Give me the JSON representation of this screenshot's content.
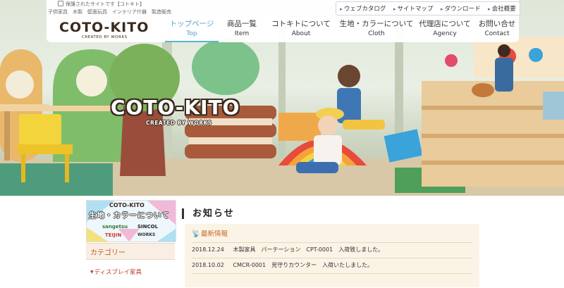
{
  "header": {
    "tagline": "保護されたサイトです【コトキト】",
    "keywords": "子供家具　木製　壁面玩具　インテリア什器　製造販売",
    "logo_text": "COTO-KITO",
    "logo_sub": "CREATED BY WORKS"
  },
  "utility_links": [
    "ウェブカタログ",
    "サイトマップ",
    "ダウンロード",
    "会社概要"
  ],
  "nav": [
    {
      "jp": "トップページ",
      "en": "Top",
      "active": true
    },
    {
      "jp": "商品一覧",
      "en": "Item",
      "active": false
    },
    {
      "jp": "コトキトについて",
      "en": "About",
      "active": false
    },
    {
      "jp": "生地・カラーについて",
      "en": "Cloth",
      "active": false
    },
    {
      "jp": "代理店について",
      "en": "Agency",
      "active": false
    },
    {
      "jp": "お問い合せ",
      "en": "Contact",
      "active": false
    }
  ],
  "hero": {
    "logo_text": "COTO-KITO",
    "logo_sub": "CREATED BY WORKS"
  },
  "sidebar": {
    "banner": {
      "logo": "COTO-KITO",
      "title": "生地・カラーについて",
      "brands": [
        "sangetsu",
        "SINCOL",
        "TEIJIN",
        "WORKS"
      ]
    },
    "category_label": "カテゴリー",
    "category_first": "ディスプレイ家具"
  },
  "news": {
    "title": "お知らせ",
    "header": "最新情報",
    "items": [
      {
        "date": "2018.12.24",
        "text": "木製家具　パーテーション　CPT-0001　入荷致しました。"
      },
      {
        "date": "2018.10.02",
        "text": "CMCR-0001　見守りカウンター　入荷いたしました。"
      }
    ]
  },
  "colors": {
    "nav_active": "#5b9fc4",
    "accent_orange": "#c05a1d",
    "news_bg": "#fbf4e6"
  }
}
